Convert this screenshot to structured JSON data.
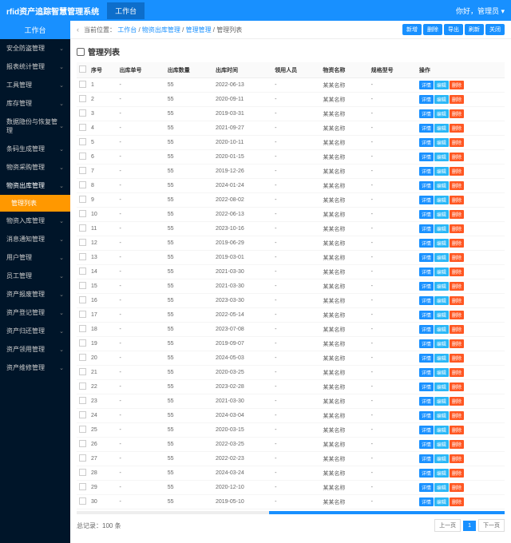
{
  "header": {
    "brand": "rfid资产追踪智慧管理系统",
    "tab": "工作台",
    "greeting": "你好，管理员"
  },
  "sidebar": {
    "workbench": "工作台",
    "items": [
      "安全防盗管理",
      "报表统计管理",
      "工具管理",
      "库存管理",
      "数据隐份与恢复管理",
      "条码生成管理",
      "物资采购管理",
      "物资出库管理",
      "物资入库管理",
      "消息通知管理",
      "用户管理",
      "员工管理",
      "资产报废管理",
      "资产登记管理",
      "资产归还管理",
      "资产领用管理",
      "资产维修管理"
    ],
    "activeIndex": 7,
    "sub": "管理列表"
  },
  "breadcrumb": {
    "label": "当前位置：",
    "parts": [
      "工作台",
      "物资出库管理",
      "管理管理",
      "管理列表"
    ]
  },
  "topButtons": [
    "新增",
    "删除",
    "导出",
    "刷新",
    "关闭"
  ],
  "panel_title": "管理列表",
  "columns": [
    "",
    "序号",
    "出库单号",
    "出库数量",
    "出库时间",
    "领用人员",
    "物资名称",
    "规格型号",
    "操作"
  ],
  "row_ops": [
    "详情",
    "编辑",
    "删除"
  ],
  "rows": [
    {
      "n": 1,
      "code": "-",
      "qty": 55,
      "date": "2022-06-13",
      "user": "-",
      "asset": "某某名称",
      "spec": "-"
    },
    {
      "n": 2,
      "code": "-",
      "qty": 55,
      "date": "2020-09-11",
      "user": "-",
      "asset": "某某名称",
      "spec": "-"
    },
    {
      "n": 3,
      "code": "-",
      "qty": 55,
      "date": "2019-03-31",
      "user": "-",
      "asset": "某某名称",
      "spec": "-"
    },
    {
      "n": 4,
      "code": "-",
      "qty": 55,
      "date": "2021-09-27",
      "user": "-",
      "asset": "某某名称",
      "spec": "-"
    },
    {
      "n": 5,
      "code": "-",
      "qty": 55,
      "date": "2020-10-11",
      "user": "-",
      "asset": "某某名称",
      "spec": "-"
    },
    {
      "n": 6,
      "code": "-",
      "qty": 55,
      "date": "2020-01-15",
      "user": "-",
      "asset": "某某名称",
      "spec": "-"
    },
    {
      "n": 7,
      "code": "-",
      "qty": 55,
      "date": "2019-12-26",
      "user": "-",
      "asset": "某某名称",
      "spec": "-"
    },
    {
      "n": 8,
      "code": "-",
      "qty": 55,
      "date": "2024-01-24",
      "user": "-",
      "asset": "某某名称",
      "spec": "-"
    },
    {
      "n": 9,
      "code": "-",
      "qty": 55,
      "date": "2022-08-02",
      "user": "-",
      "asset": "某某名称",
      "spec": "-"
    },
    {
      "n": 10,
      "code": "-",
      "qty": 55,
      "date": "2022-06-13",
      "user": "-",
      "asset": "某某名称",
      "spec": "-"
    },
    {
      "n": 11,
      "code": "-",
      "qty": 55,
      "date": "2023-10-16",
      "user": "-",
      "asset": "某某名称",
      "spec": "-"
    },
    {
      "n": 12,
      "code": "-",
      "qty": 55,
      "date": "2019-06-29",
      "user": "-",
      "asset": "某某名称",
      "spec": "-"
    },
    {
      "n": 13,
      "code": "-",
      "qty": 55,
      "date": "2019-03-01",
      "user": "-",
      "asset": "某某名称",
      "spec": "-"
    },
    {
      "n": 14,
      "code": "-",
      "qty": 55,
      "date": "2021-03-30",
      "user": "-",
      "asset": "某某名称",
      "spec": "-"
    },
    {
      "n": 15,
      "code": "-",
      "qty": 55,
      "date": "2021-03-30",
      "user": "-",
      "asset": "某某名称",
      "spec": "-"
    },
    {
      "n": 16,
      "code": "-",
      "qty": 55,
      "date": "2023-03-30",
      "user": "-",
      "asset": "某某名称",
      "spec": "-"
    },
    {
      "n": 17,
      "code": "-",
      "qty": 55,
      "date": "2022-05-14",
      "user": "-",
      "asset": "某某名称",
      "spec": "-"
    },
    {
      "n": 18,
      "code": "-",
      "qty": 55,
      "date": "2023-07-08",
      "user": "-",
      "asset": "某某名称",
      "spec": "-"
    },
    {
      "n": 19,
      "code": "-",
      "qty": 55,
      "date": "2019-09-07",
      "user": "-",
      "asset": "某某名称",
      "spec": "-"
    },
    {
      "n": 20,
      "code": "-",
      "qty": 55,
      "date": "2024-05-03",
      "user": "-",
      "asset": "某某名称",
      "spec": "-"
    },
    {
      "n": 21,
      "code": "-",
      "qty": 55,
      "date": "2020-03-25",
      "user": "-",
      "asset": "某某名称",
      "spec": "-"
    },
    {
      "n": 22,
      "code": "-",
      "qty": 55,
      "date": "2023-02-28",
      "user": "-",
      "asset": "某某名称",
      "spec": "-"
    },
    {
      "n": 23,
      "code": "-",
      "qty": 55,
      "date": "2021-03-30",
      "user": "-",
      "asset": "某某名称",
      "spec": "-"
    },
    {
      "n": 24,
      "code": "-",
      "qty": 55,
      "date": "2024-03-04",
      "user": "-",
      "asset": "某某名称",
      "spec": "-"
    },
    {
      "n": 25,
      "code": "-",
      "qty": 55,
      "date": "2020-03-15",
      "user": "-",
      "asset": "某某名称",
      "spec": "-"
    },
    {
      "n": 26,
      "code": "-",
      "qty": 55,
      "date": "2022-03-25",
      "user": "-",
      "asset": "某某名称",
      "spec": "-"
    },
    {
      "n": 27,
      "code": "-",
      "qty": 55,
      "date": "2022-02-23",
      "user": "-",
      "asset": "某某名称",
      "spec": "-"
    },
    {
      "n": 28,
      "code": "-",
      "qty": 55,
      "date": "2024-03-24",
      "user": "-",
      "asset": "某某名称",
      "spec": "-"
    },
    {
      "n": 29,
      "code": "-",
      "qty": 55,
      "date": "2020-12-10",
      "user": "-",
      "asset": "某某名称",
      "spec": "-"
    },
    {
      "n": 30,
      "code": "-",
      "qty": 55,
      "date": "2019-05-10",
      "user": "-",
      "asset": "某某名称",
      "spec": "-"
    }
  ],
  "footer": {
    "total": "总记录：100 条",
    "prev": "上一页",
    "page": "1",
    "next": "下一页"
  }
}
